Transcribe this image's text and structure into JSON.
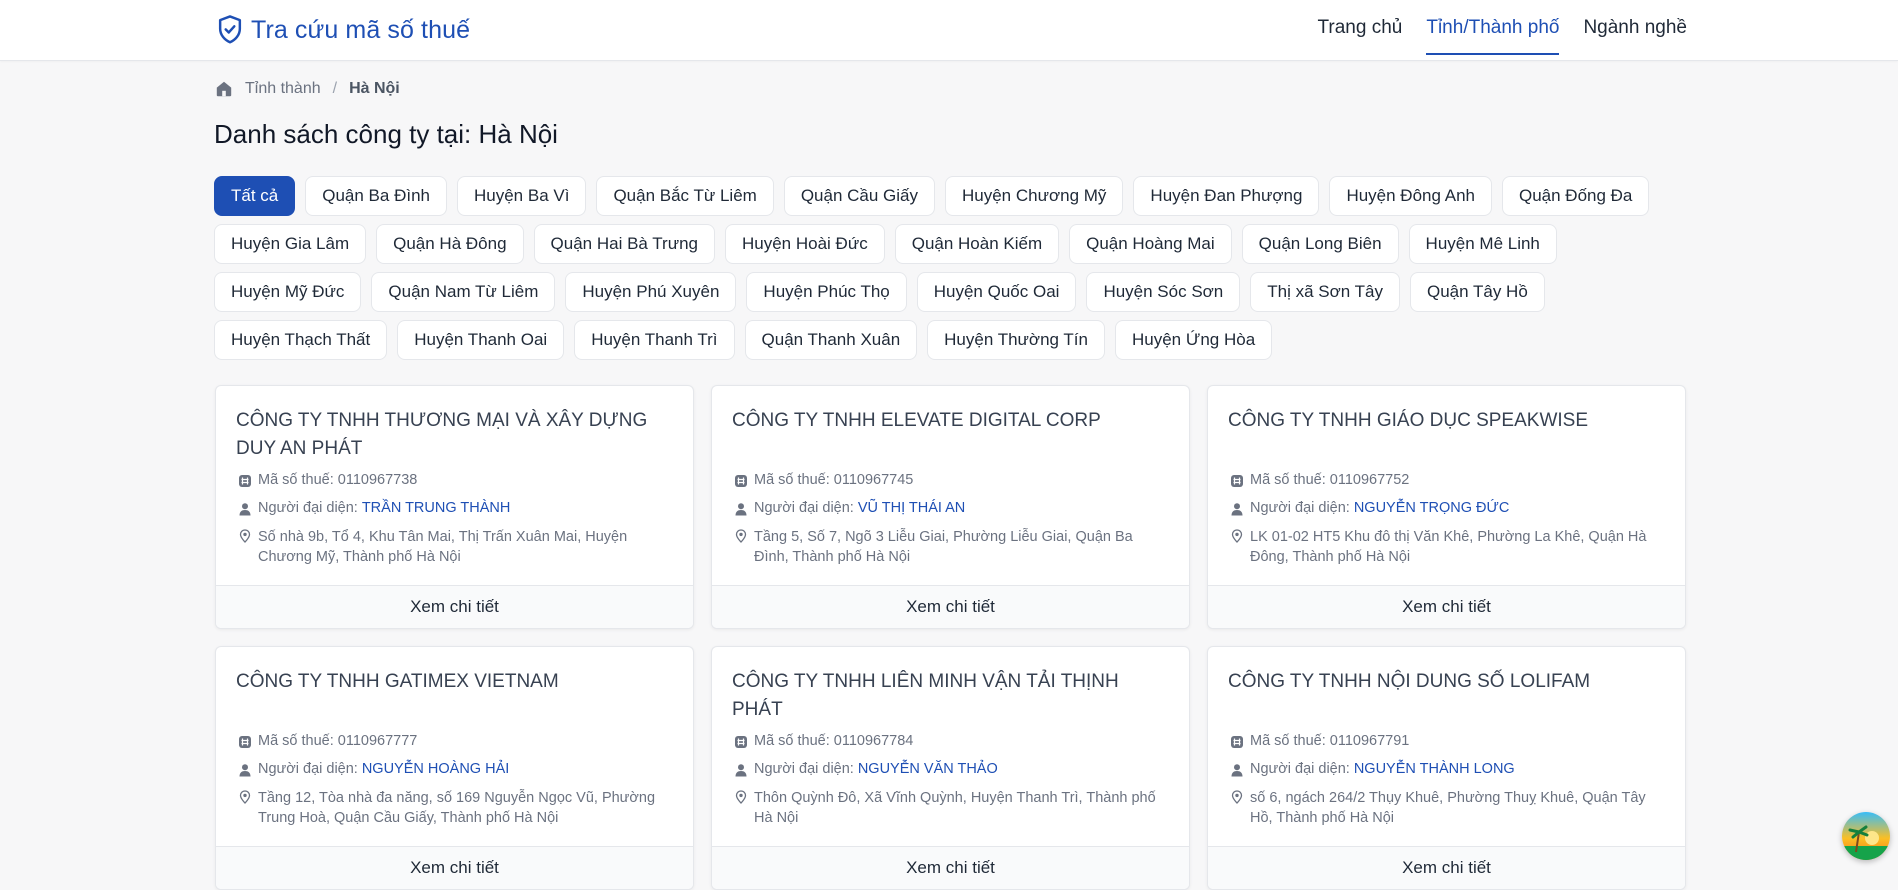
{
  "header": {
    "brand": "Tra cứu mã số thuế",
    "nav": [
      "Trang chủ",
      "Tỉnh/Thành phố",
      "Ngành nghề"
    ],
    "active_nav": "Tỉnh/Thành phố"
  },
  "breadcrumb": {
    "parent": "Tỉnh thành",
    "current": "Hà Nội"
  },
  "page_title": "Danh sách công ty tại: Hà Nội",
  "filters": [
    "Tất cả",
    "Quận Ba Đình",
    "Huyện Ba Vì",
    "Quận Bắc Từ Liêm",
    "Quận Cầu Giấy",
    "Huyện Chương Mỹ",
    "Huyện Đan Phượng",
    "Huyện Đông Anh",
    "Quận Đống Đa",
    "Huyện Gia Lâm",
    "Quận Hà Đông",
    "Quận Hai Bà Trưng",
    "Huyện Hoài Đức",
    "Quận Hoàn Kiếm",
    "Quận Hoàng Mai",
    "Quận Long Biên",
    "Huyện Mê Linh",
    "Huyện Mỹ Đức",
    "Quận Nam Từ Liêm",
    "Huyện Phú Xuyên",
    "Huyện Phúc Thọ",
    "Huyện Quốc Oai",
    "Huyện Sóc Sơn",
    "Thị xã Sơn Tây",
    "Quận Tây Hồ",
    "Huyện Thạch Thất",
    "Huyện Thanh Oai",
    "Huyện Thanh Trì",
    "Quận Thanh Xuân",
    "Huyện Thường Tín",
    "Huyện Ứng Hòa"
  ],
  "active_filter": "Tất cả",
  "labels": {
    "tax": "Mã số thuế:",
    "rep": "Người đại diện:",
    "detail": "Xem chi tiết"
  },
  "companies": [
    {
      "name": "CÔNG TY TNHH THƯƠNG MẠI VÀ XÂY DỰNG DUY AN PHÁT",
      "tax": "0110967738",
      "rep": "TRẦN TRUNG THÀNH",
      "address": "Số nhà 9b, Tổ 4, Khu Tân Mai, Thị Trấn Xuân Mai, Huyện Chương Mỹ, Thành phố Hà Nội"
    },
    {
      "name": "CÔNG TY TNHH ELEVATE DIGITAL CORP",
      "tax": "0110967745",
      "rep": "VŨ THỊ THÁI AN",
      "address": "Tầng 5, Số 7, Ngõ 3 Liễu Giai, Phường Liễu Giai, Quận Ba Đình, Thành phố Hà Nội"
    },
    {
      "name": "CÔNG TY TNHH GIÁO DỤC SPEAKWISE",
      "tax": "0110967752",
      "rep": "NGUYỄN TRỌNG ĐỨC",
      "address": "LK 01-02 HT5 Khu đô thị Văn Khê, Phường La Khê, Quận Hà Đông, Thành phố Hà Nội"
    },
    {
      "name": "CÔNG TY TNHH GATIMEX VIETNAM",
      "tax": "0110967777",
      "rep": "NGUYỄN HOÀNG HẢI",
      "address": "Tầng 12, Tòa nhà đa năng, số 169 Nguyễn Ngọc Vũ, Phường Trung Hoà, Quận Cầu Giấy, Thành phố Hà Nội"
    },
    {
      "name": "CÔNG TY TNHH LIÊN MINH VẬN TẢI THỊNH PHÁT",
      "tax": "0110967784",
      "rep": "NGUYỄN VĂN THẢO",
      "address": "Thôn Quỳnh Đô, Xã Vĩnh Quỳnh, Huyện Thanh Trì, Thành phố Hà Nội"
    },
    {
      "name": "CÔNG TY TNHH NỘI DUNG SỐ LOLIFAM",
      "tax": "0110967791",
      "rep": "NGUYỄN THÀNH LONG",
      "address": "số 6, ngách 264/2 Thụy Khuê, Phường Thuỵ Khuê, Quận Tây Hồ, Thành phố Hà Nội"
    }
  ],
  "colors": {
    "primary": "#1e4fb4",
    "text": "#1f2937",
    "muted": "#6b7280",
    "border": "#e5e7eb",
    "background": "#f7f7f8"
  },
  "icons": {
    "brand": "shield-check-icon",
    "breadcrumb": "home-icon",
    "tax": "grid-icon",
    "rep": "user-icon",
    "address": "map-pin-icon",
    "floating": "avatar-bubble"
  }
}
